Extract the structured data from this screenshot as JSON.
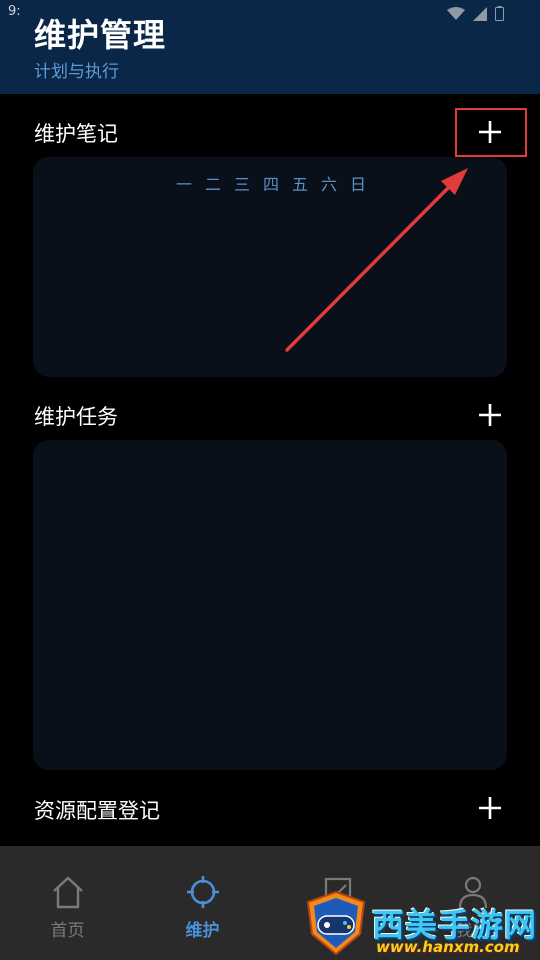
{
  "status": {
    "time": "9:"
  },
  "header": {
    "title": "维护管理",
    "subtitle": "计划与执行"
  },
  "sections": {
    "notes": {
      "title": "维护笔记",
      "add_icon": "plus-icon"
    },
    "tasks": {
      "title": "维护任务",
      "add_icon": "plus-icon"
    },
    "resources": {
      "title": "资源配置登记",
      "add_icon": "plus-icon"
    }
  },
  "calendar": {
    "weekdays": [
      "一",
      "二",
      "三",
      "四",
      "五",
      "六",
      "日"
    ]
  },
  "annotation": {
    "color": "#e23b3b"
  },
  "bottom_nav": {
    "items": [
      {
        "label": "首页",
        "icon": "home-icon",
        "active": false
      },
      {
        "label": "维护",
        "icon": "crosshair-icon",
        "active": true
      },
      {
        "label": "",
        "icon": "edit-icon",
        "active": false
      },
      {
        "label": "我的",
        "icon": "person-icon",
        "active": false
      }
    ]
  },
  "watermark": {
    "title": "西美手游网",
    "url": "www.hanxm.com"
  },
  "colors": {
    "header_bg": "#0b2747",
    "accent": "#4c8fd8",
    "card_bg": "#0a1019"
  }
}
